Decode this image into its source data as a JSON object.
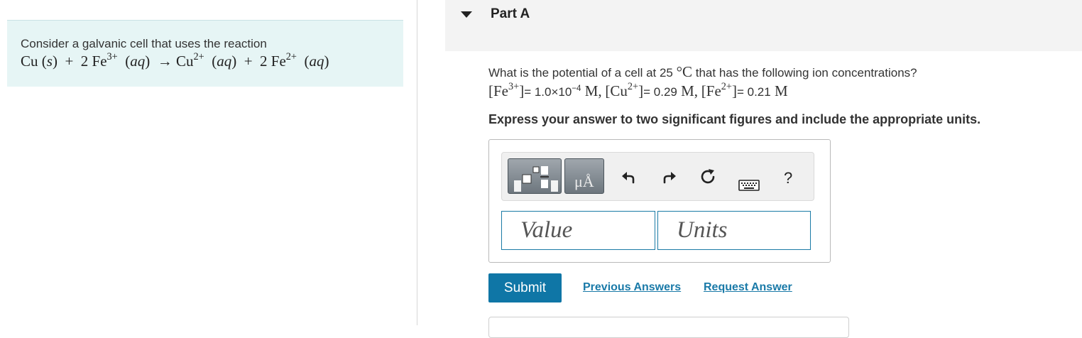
{
  "info": {
    "intro": "Consider a galvanic cell that uses the reaction",
    "reaction": {
      "lhs_species": "Cu",
      "lhs_state": "s",
      "plus": "+",
      "coef_fe3": "2",
      "fe3_species": "Fe",
      "fe3_charge": "3+",
      "fe3_state": "aq",
      "arrow": "→",
      "cu2_species": "Cu",
      "cu2_charge": "2+",
      "cu2_state": "aq",
      "coef_fe2": "2",
      "fe2_species": "Fe",
      "fe2_charge": "2+",
      "fe2_state": "aq"
    }
  },
  "part": {
    "title": "Part A"
  },
  "question": {
    "text_before": "What is the potential of a cell at 25 ",
    "temp_unit": "°C",
    "text_after": " that has the following ion concentrations?",
    "conc": {
      "fe3_label": "Fe",
      "fe3_charge": "3+",
      "fe3_value": "= 1.0×10",
      "fe3_exp": "−4",
      "fe3_unit": " M",
      "cu2_label": "Cu",
      "cu2_charge": "2+",
      "cu2_value": "= 0.29",
      "cu2_unit": " M",
      "fe2_label": "Fe",
      "fe2_charge": "2+",
      "fe2_value": "= 0.21",
      "fe2_unit": " M",
      "separator": ","
    },
    "instruction": "Express your answer to two significant figures and include the appropriate units."
  },
  "toolbar": {
    "units_button_label": "μÅ",
    "help_label": "?",
    "icons": [
      "templates-icon",
      "units-icon",
      "undo-icon",
      "redo-icon",
      "reset-icon",
      "keyboard-icon",
      "help-icon"
    ]
  },
  "answer": {
    "value_placeholder": "Value",
    "units_placeholder": "Units"
  },
  "actions": {
    "submit_label": "Submit",
    "previous_answers_label": "Previous Answers",
    "request_answer_label": "Request Answer"
  },
  "colors": {
    "panel_bg": "#e6f5f5",
    "accent": "#0f76a6",
    "link": "#1a7aa8"
  }
}
